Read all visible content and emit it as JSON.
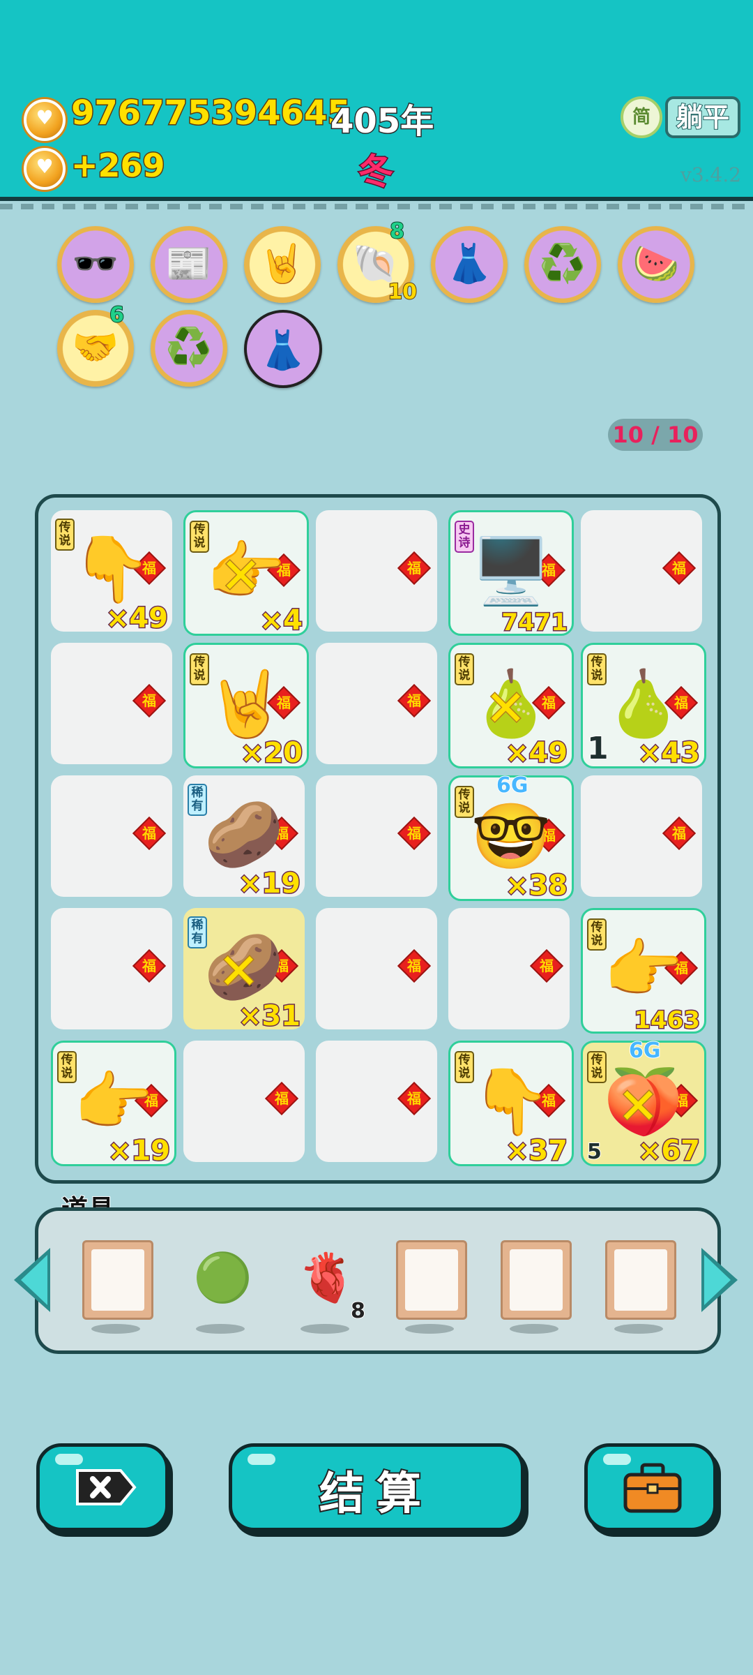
{
  "header": {
    "money": "976775394645",
    "year": "405年",
    "income": "+269",
    "season": "冬",
    "simp_label": "简",
    "mode_button": "躺平",
    "version": "v3.4.2"
  },
  "relics": [
    {
      "icon": "sunglasses-icon",
      "glyph": "🕶️",
      "style": "purple"
    },
    {
      "icon": "time-magazine-icon",
      "glyph": "📰",
      "style": "purple"
    },
    {
      "icon": "rock-hand-icon",
      "glyph": "🤘",
      "style": "gold"
    },
    {
      "icon": "shell-icon",
      "glyph": "🐚",
      "style": "gold",
      "badge_top": "8",
      "badge_bottom": "10"
    },
    {
      "icon": "skirt-icon",
      "glyph": "👗",
      "style": "purple"
    },
    {
      "icon": "recycle-icon",
      "glyph": "♻️",
      "style": "purple"
    },
    {
      "icon": "fruit-platter-icon",
      "glyph": "🍉",
      "style": "purple"
    },
    {
      "icon": "handshake-icon",
      "glyph": "🤝",
      "style": "gold",
      "badge_top": "6"
    },
    {
      "icon": "recycle-icon",
      "glyph": "♻️",
      "style": "purple"
    },
    {
      "icon": "skirt-icon",
      "glyph": "👗",
      "style": "dark"
    }
  ],
  "slots": "10 / 10",
  "board": {
    "fu": "福",
    "tags": {
      "legend": "传说",
      "rare": "稀有",
      "epic": "史诗"
    },
    "cells": [
      {
        "tag": "legend",
        "icon": "pointing-hand-icon",
        "glyph": "👇",
        "count": "×49"
      },
      {
        "tag": "legend",
        "icon": "pointing-hand-icon",
        "glyph": "👉",
        "count": "×4",
        "selected": true,
        "x": true
      },
      {},
      {
        "tag": "epic",
        "icon": "gpu-king-icon",
        "glyph": "🖥️",
        "count": "7471",
        "selected": true
      },
      {},
      {},
      {
        "tag": "legend",
        "icon": "rock-hand-icon",
        "glyph": "🤘",
        "count": "×20",
        "selected": true
      },
      {},
      {
        "tag": "legend",
        "icon": "pear-icon",
        "glyph": "🍐",
        "count": "×49",
        "selected": true,
        "x": true
      },
      {
        "tag": "legend",
        "icon": "pear-icon",
        "glyph": "🍐",
        "count": "×43",
        "selected": true,
        "left_num": "1"
      },
      {},
      {
        "tag": "rare",
        "icon": "potato-icon",
        "glyph": "🥔",
        "count": "×19"
      },
      {},
      {
        "tag": "legend",
        "icon": "king-face-icon",
        "glyph": "🤓",
        "count": "×38",
        "selected": true,
        "top_label": "6G"
      },
      {},
      {},
      {
        "tag": "rare",
        "icon": "potato-icon",
        "glyph": "🥔",
        "count": "×31",
        "highlight": true,
        "x": true
      },
      {},
      {},
      {
        "tag": "legend",
        "icon": "pointing-hand-icon",
        "glyph": "👉",
        "count": "1463",
        "selected": true
      },
      {
        "tag": "legend",
        "icon": "pointing-hand-icon",
        "glyph": "👉",
        "count": "×19",
        "selected": true
      },
      {},
      {},
      {
        "tag": "legend",
        "icon": "pointing-hand-icon",
        "glyph": "👇",
        "count": "×37",
        "selected": true
      },
      {
        "tag": "legend",
        "icon": "crowned-fruit-icon",
        "glyph": "🍑",
        "count": "×67",
        "selected": true,
        "highlight": true,
        "top_label": "6G",
        "left_num": "5",
        "x": true
      }
    ]
  },
  "items": {
    "label": "道具",
    "slots": [
      {
        "icon": "empty-frame"
      },
      {
        "icon": "green-orb-icon",
        "glyph": "🟢"
      },
      {
        "icon": "liver-icon",
        "glyph": "🫀",
        "count": "8"
      },
      {
        "icon": "empty-frame"
      },
      {
        "icon": "empty-frame"
      },
      {
        "icon": "empty-frame"
      }
    ]
  },
  "buttons": {
    "settle": "结算"
  }
}
